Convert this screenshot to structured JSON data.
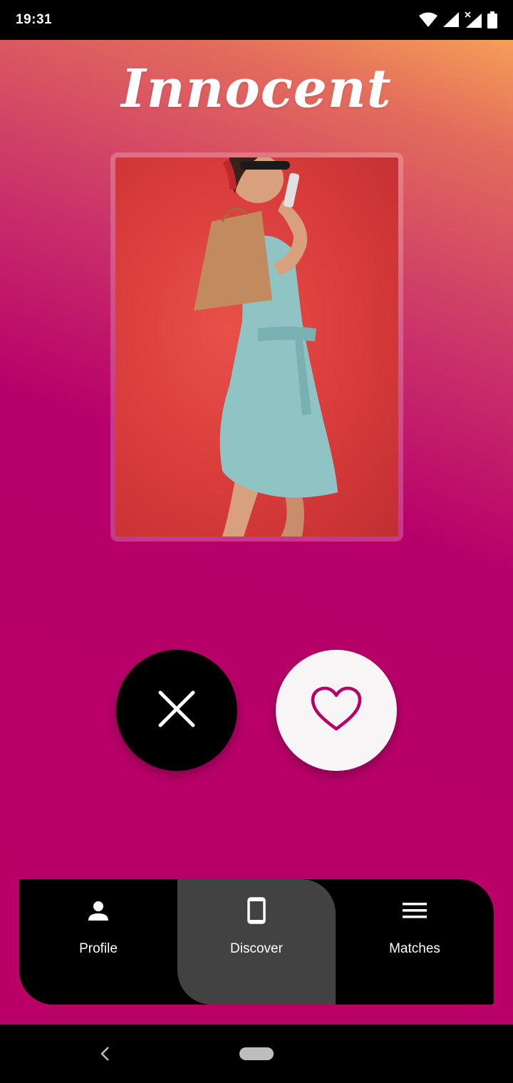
{
  "status_bar": {
    "time": "19:31",
    "icons": [
      "wifi-icon",
      "cell-signal-icon",
      "cell-signal-x-icon",
      "battery-icon"
    ]
  },
  "app": {
    "logo_text": "Innocent"
  },
  "profile_card": {
    "photo_description_icon": "profile-photo"
  },
  "actions": {
    "dislike_icon": "close-icon",
    "like_icon": "heart-outline-icon"
  },
  "bottom_nav": {
    "items": [
      {
        "label": "Profile",
        "icon": "person-icon",
        "active": false
      },
      {
        "label": "Discover",
        "icon": "phone-device-icon",
        "active": true
      },
      {
        "label": "Matches",
        "icon": "menu-lines-icon",
        "active": false
      }
    ]
  },
  "colors": {
    "gradient_top": "#fcb055",
    "gradient_mid": "#c9306a",
    "gradient_bottom": "#b80066",
    "like_accent": "#b80066",
    "nav_active_bg": "#424242"
  }
}
